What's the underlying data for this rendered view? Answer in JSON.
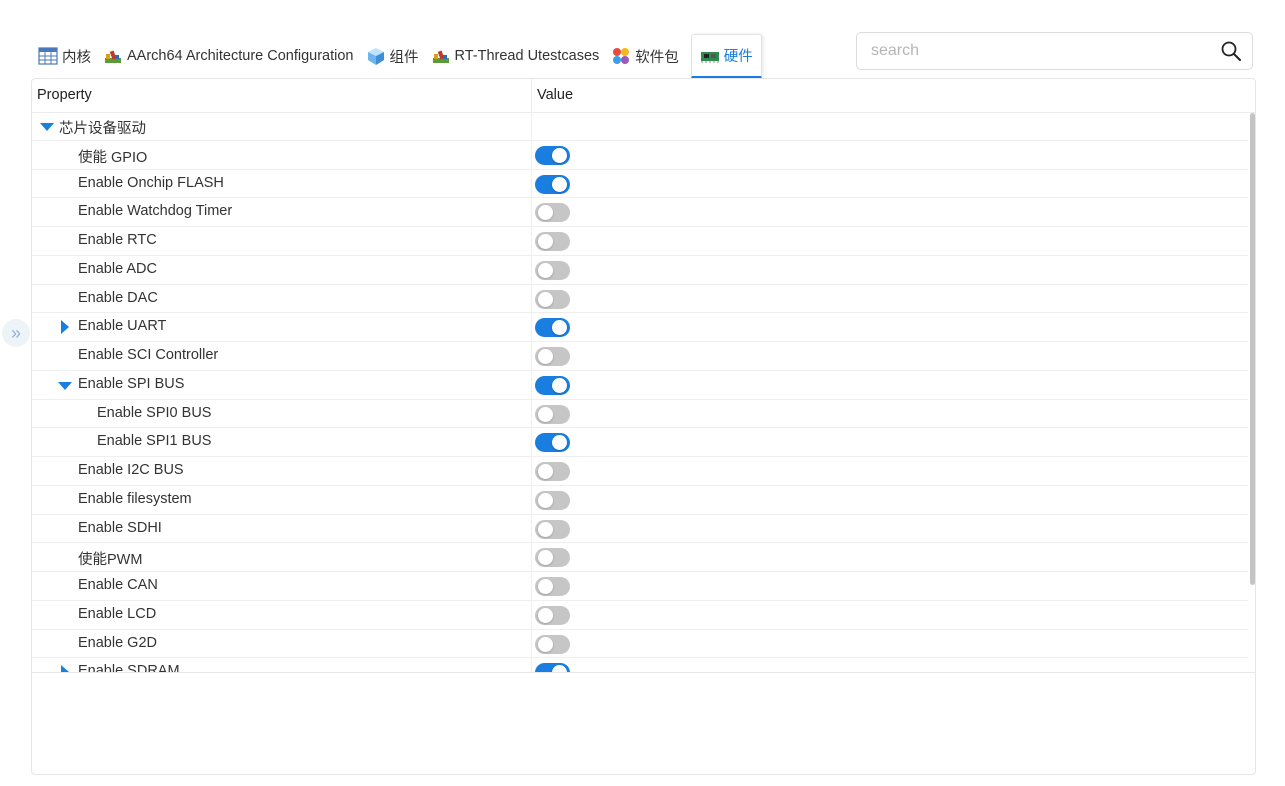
{
  "tabs": [
    {
      "label": "内核",
      "icon": "table-icon",
      "active": false
    },
    {
      "label": "AArch64 Architecture Configuration",
      "icon": "books-icon",
      "active": false
    },
    {
      "label": "组件",
      "icon": "cube-icon",
      "active": false
    },
    {
      "label": "RT-Thread Utestcases",
      "icon": "books-icon",
      "active": false
    },
    {
      "label": "软件包",
      "icon": "packages-icon",
      "active": false
    },
    {
      "label": "硬件",
      "icon": "board-icon",
      "active": true
    }
  ],
  "search": {
    "placeholder": "search",
    "value": ""
  },
  "table": {
    "col_property": "Property",
    "col_value": "Value",
    "rows": [
      {
        "label": "芯片设备驱动",
        "level": 0,
        "expander": "down",
        "toggle": null
      },
      {
        "label": "使能 GPIO",
        "level": 1,
        "expander": null,
        "toggle": true
      },
      {
        "label": "Enable Onchip FLASH",
        "level": 1,
        "expander": null,
        "toggle": true
      },
      {
        "label": "Enable Watchdog Timer",
        "level": 1,
        "expander": null,
        "toggle": false
      },
      {
        "label": "Enable RTC",
        "level": 1,
        "expander": null,
        "toggle": false
      },
      {
        "label": "Enable ADC",
        "level": 1,
        "expander": null,
        "toggle": false
      },
      {
        "label": "Enable DAC",
        "level": 1,
        "expander": null,
        "toggle": false
      },
      {
        "label": "Enable UART",
        "level": 1,
        "expander": "right",
        "toggle": true
      },
      {
        "label": "Enable SCI Controller",
        "level": 1,
        "expander": null,
        "toggle": false
      },
      {
        "label": "Enable SPI BUS",
        "level": 1,
        "expander": "down",
        "toggle": true
      },
      {
        "label": "Enable SPI0 BUS",
        "level": 2,
        "expander": null,
        "toggle": false
      },
      {
        "label": "Enable SPI1 BUS",
        "level": 2,
        "expander": null,
        "toggle": true
      },
      {
        "label": "Enable I2C BUS",
        "level": 1,
        "expander": null,
        "toggle": false
      },
      {
        "label": "Enable filesystem",
        "level": 1,
        "expander": null,
        "toggle": false
      },
      {
        "label": "Enable SDHI",
        "level": 1,
        "expander": null,
        "toggle": false
      },
      {
        "label": "使能PWM",
        "level": 1,
        "expander": null,
        "toggle": false
      },
      {
        "label": "Enable CAN",
        "level": 1,
        "expander": null,
        "toggle": false
      },
      {
        "label": "Enable LCD",
        "level": 1,
        "expander": null,
        "toggle": false
      },
      {
        "label": "Enable G2D",
        "level": 1,
        "expander": null,
        "toggle": false
      },
      {
        "label": "Enable SDRAM",
        "level": 1,
        "expander": "right",
        "toggle": true
      }
    ]
  },
  "side_expander": {
    "glyph": "»"
  },
  "colors": {
    "accent": "#1a7ee0",
    "toggle_off": "#c6c6c6"
  }
}
